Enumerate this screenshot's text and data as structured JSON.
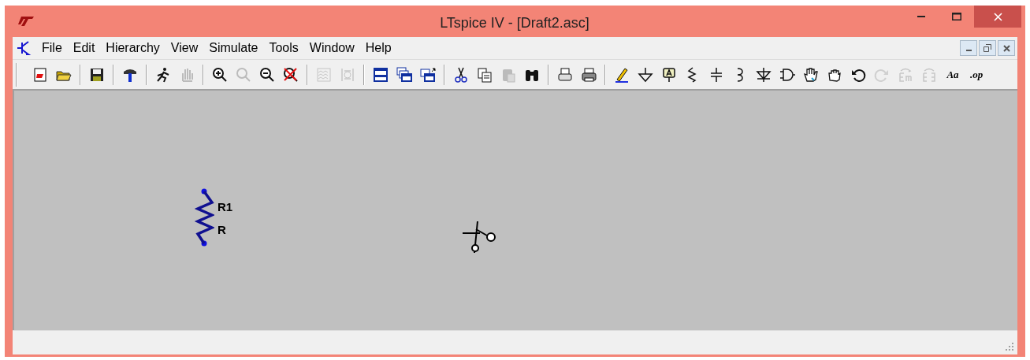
{
  "window": {
    "title": "LTspice IV - [Draft2.asc]"
  },
  "menu": [
    {
      "label": "File"
    },
    {
      "label": "Edit"
    },
    {
      "label": "Hierarchy"
    },
    {
      "label": "View"
    },
    {
      "label": "Simulate"
    },
    {
      "label": "Tools"
    },
    {
      "label": "Window"
    },
    {
      "label": "Help"
    }
  ],
  "toolbar": [
    {
      "kind": "button",
      "disabled": false
    },
    {
      "kind": "button",
      "disabled": false
    },
    {
      "kind": "separator"
    },
    {
      "kind": "button",
      "disabled": false
    },
    {
      "kind": "separator"
    },
    {
      "kind": "button",
      "disabled": false
    },
    {
      "kind": "separator"
    },
    {
      "kind": "button",
      "disabled": false
    },
    {
      "kind": "button",
      "disabled": true
    },
    {
      "kind": "separator"
    },
    {
      "kind": "button",
      "disabled": false
    },
    {
      "kind": "button",
      "disabled": true
    },
    {
      "kind": "button",
      "disabled": false
    },
    {
      "kind": "button",
      "disabled": false
    },
    {
      "kind": "separator"
    },
    {
      "kind": "button",
      "disabled": true
    },
    {
      "kind": "button",
      "disabled": true
    },
    {
      "kind": "separator"
    },
    {
      "kind": "button",
      "disabled": false
    },
    {
      "kind": "button",
      "disabled": false
    },
    {
      "kind": "button",
      "disabled": false
    },
    {
      "kind": "separator"
    },
    {
      "kind": "button",
      "disabled": false
    },
    {
      "kind": "button",
      "disabled": false
    },
    {
      "kind": "button",
      "disabled": true
    },
    {
      "kind": "button",
      "disabled": false
    },
    {
      "kind": "separator"
    },
    {
      "kind": "button",
      "disabled": false
    },
    {
      "kind": "button",
      "disabled": false
    },
    {
      "kind": "separator"
    },
    {
      "kind": "button",
      "disabled": false
    },
    {
      "kind": "button",
      "disabled": false
    },
    {
      "kind": "button",
      "disabled": false
    },
    {
      "kind": "button",
      "disabled": false
    },
    {
      "kind": "button",
      "disabled": false
    },
    {
      "kind": "button",
      "disabled": false
    },
    {
      "kind": "button",
      "disabled": false
    },
    {
      "kind": "button",
      "disabled": false
    },
    {
      "kind": "button",
      "disabled": false
    },
    {
      "kind": "button",
      "disabled": false
    },
    {
      "kind": "button",
      "disabled": false
    },
    {
      "kind": "button",
      "disabled": true
    },
    {
      "kind": "button",
      "disabled": true
    },
    {
      "kind": "button",
      "disabled": true
    },
    {
      "kind": "text",
      "label": "Aa",
      "disabled": false
    },
    {
      "kind": "text",
      "label": ".op",
      "disabled": false
    }
  ],
  "schematic": {
    "components": [
      {
        "kind": "resistor",
        "name": "R1",
        "value": "R"
      }
    ]
  }
}
